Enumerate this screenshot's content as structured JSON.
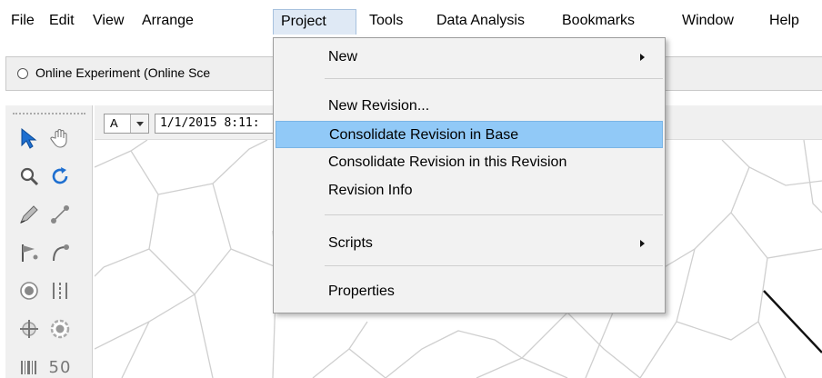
{
  "menubar": {
    "items": [
      "File",
      "Edit",
      "View",
      "Arrange",
      "Project",
      "Tools",
      "Data Analysis",
      "Bookmarks",
      "Window",
      "Help"
    ],
    "open_item": "Project"
  },
  "tab": {
    "label": "Online Experiment (Online Sce"
  },
  "map_toolbar": {
    "layer_value": "A",
    "time_value": "1/1/2015 8:11:"
  },
  "project_menu": {
    "items": [
      {
        "label": "New",
        "submenu": true
      },
      {
        "label": "New Revision...",
        "submenu": false
      },
      {
        "label": "Consolidate Revision in Base",
        "submenu": false,
        "highlighted": true
      },
      {
        "label": "Consolidate Revision in this Revision",
        "submenu": false
      },
      {
        "label": "Revision Info",
        "submenu": false
      },
      {
        "label": "Scripts",
        "submenu": true
      },
      {
        "label": "Properties",
        "submenu": false
      }
    ]
  },
  "palette": {
    "icons": [
      "select-arrow-icon",
      "pan-hand-icon",
      "zoom-magnifier-icon",
      "rotate-icon",
      "draw-pen-icon",
      "node-link-icon",
      "point-flag-icon",
      "curve-link-icon",
      "target-radio-icon",
      "dashed-bars-icon",
      "crosshair-icon",
      "ring-target-icon",
      "barcode-icon",
      "speed-limit-icon"
    ],
    "speed_text": "50"
  },
  "colors": {
    "menu_highlight": "#91c9f7",
    "open_menu_header": "#dfe9f5",
    "select_arrow": "#1e6fd0"
  }
}
